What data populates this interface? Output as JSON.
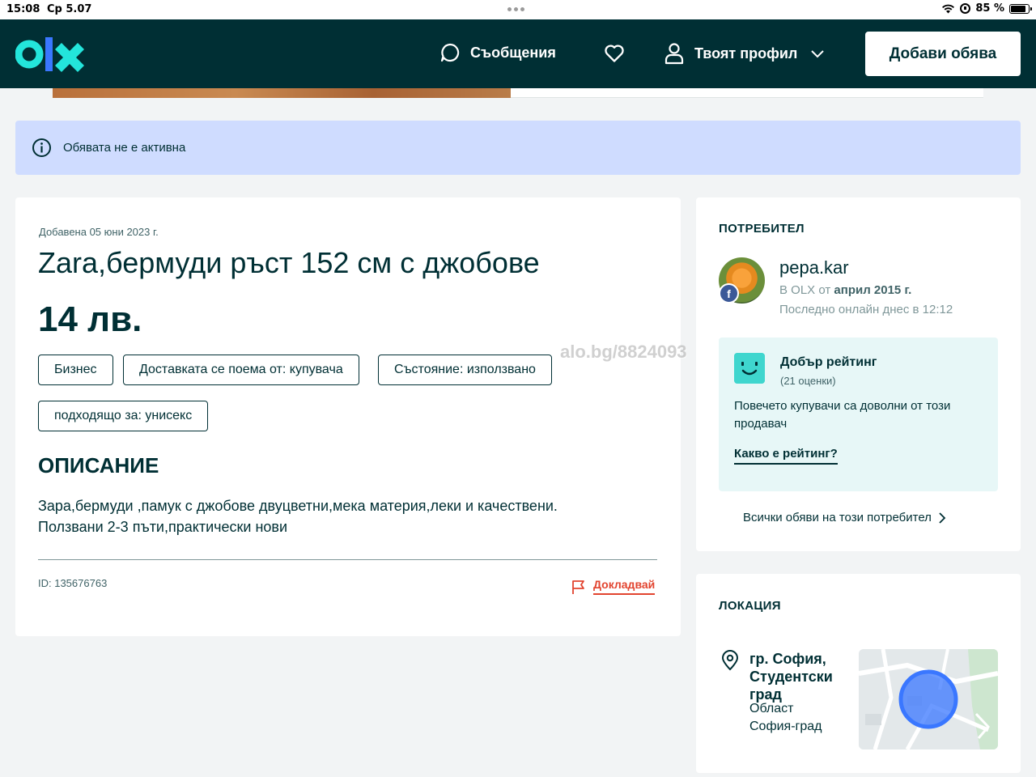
{
  "status_bar": {
    "time": "15:08",
    "date": "Ср 5.07",
    "battery": "85 %",
    "battery_level": 0.85
  },
  "header": {
    "logo_text": "olx",
    "messages_label": "Съобщения",
    "profile_label": "Твоят профил",
    "add_button_label": "Добави обява",
    "background_color": "#002f34",
    "logo_color": "#23e5db"
  },
  "banner": {
    "text": "Обявата не е активна",
    "background_color": "#cfdcff"
  },
  "ad": {
    "added_date": "Добавена 05 юни 2023 г.",
    "title": "Zara,бермуди ръст 152 см с джобове",
    "price": "14 лв.",
    "tags": [
      "Бизнес",
      "Доставката се поема от: купувача",
      "Състояние: използвано",
      "подходящо за: унисекс"
    ],
    "description_heading": "ОПИСАНИЕ",
    "description_lines": [
      "Зара,бермуди ,памук с джобове двуцветни,мека материя,леки и качествени.",
      "Ползвани 2-3 пъти,практически нови"
    ],
    "id_text": "ID: 135676763",
    "report_label": "Докладвай"
  },
  "user": {
    "section_heading": "ПОТРЕБИТЕЛ",
    "username": "pepa.kar",
    "since_prefix": "В OLX от",
    "since_date": "април 2015 г.",
    "last_seen": "Последно онлайн днес в 12:12",
    "rating_title": "Добър рейтинг",
    "rating_count": "(21 оценки)",
    "rating_description": "Повечето купувачи са доволни от този продавач",
    "rating_link": "Какво е рейтинг?",
    "all_ads_link": "Всички обяви на този потребител"
  },
  "location": {
    "section_heading": "ЛОКАЦИЯ",
    "city": "гр. София, Студентски град",
    "region_label": "Област",
    "region": "София-град"
  },
  "watermark": "alo.bg/8824093"
}
